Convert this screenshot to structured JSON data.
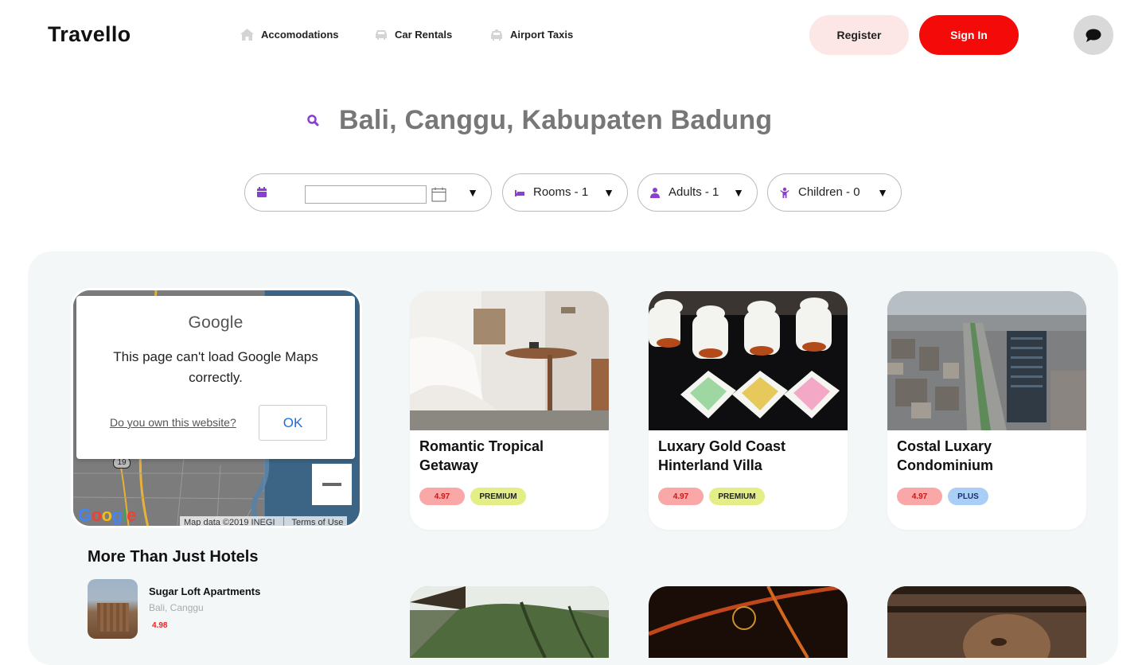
{
  "header": {
    "logo": "Travello",
    "nav": [
      {
        "label": "Accomodations",
        "icon": "home-icon"
      },
      {
        "label": "Car Rentals",
        "icon": "car-icon"
      },
      {
        "label": "Airport Taxis",
        "icon": "taxi-icon"
      }
    ],
    "register_label": "Register",
    "signin_label": "Sign In",
    "chat_icon": "chat-icon"
  },
  "search": {
    "query": "Bali, Canggu, Kabupaten Badung",
    "icon": "search-icon"
  },
  "filters": {
    "date": {
      "icon": "calendar-icon",
      "value": ""
    },
    "rooms": {
      "label": "Rooms - 1",
      "icon": "bed-icon"
    },
    "adults": {
      "label": "Adults - 1",
      "icon": "person-icon"
    },
    "children": {
      "label": "Children - 0",
      "icon": "child-icon"
    }
  },
  "map": {
    "dialog_brand": "Google",
    "dialog_message": "This page can't load Google Maps correctly.",
    "dialog_link": "Do you own this website?",
    "dialog_ok": "OK",
    "road_number": "19",
    "brand": "Google",
    "credit": "Map data ©2019 INEGI",
    "terms": "Terms of Use"
  },
  "more": {
    "title": "More Than Just Hotels",
    "items": [
      {
        "name": "Sugar Loft Apartments",
        "location": "Bali, Canggu",
        "rating": "4.98"
      }
    ]
  },
  "listings": [
    {
      "title": "Romantic Tropical Getaway",
      "rating": "4.97",
      "tier": "PREMIUM"
    },
    {
      "title": "Luxary Gold Coast Hinterland Villa",
      "rating": "4.97",
      "tier": "PREMIUM"
    },
    {
      "title": "Costal Luxary Condominium",
      "rating": "4.97",
      "tier": "PLUS"
    }
  ],
  "colors": {
    "brand_red": "#f50a0a",
    "register_bg": "#fde6e6",
    "accent_purple": "#8a3fd1",
    "panel_bg": "#f4f7f8"
  }
}
